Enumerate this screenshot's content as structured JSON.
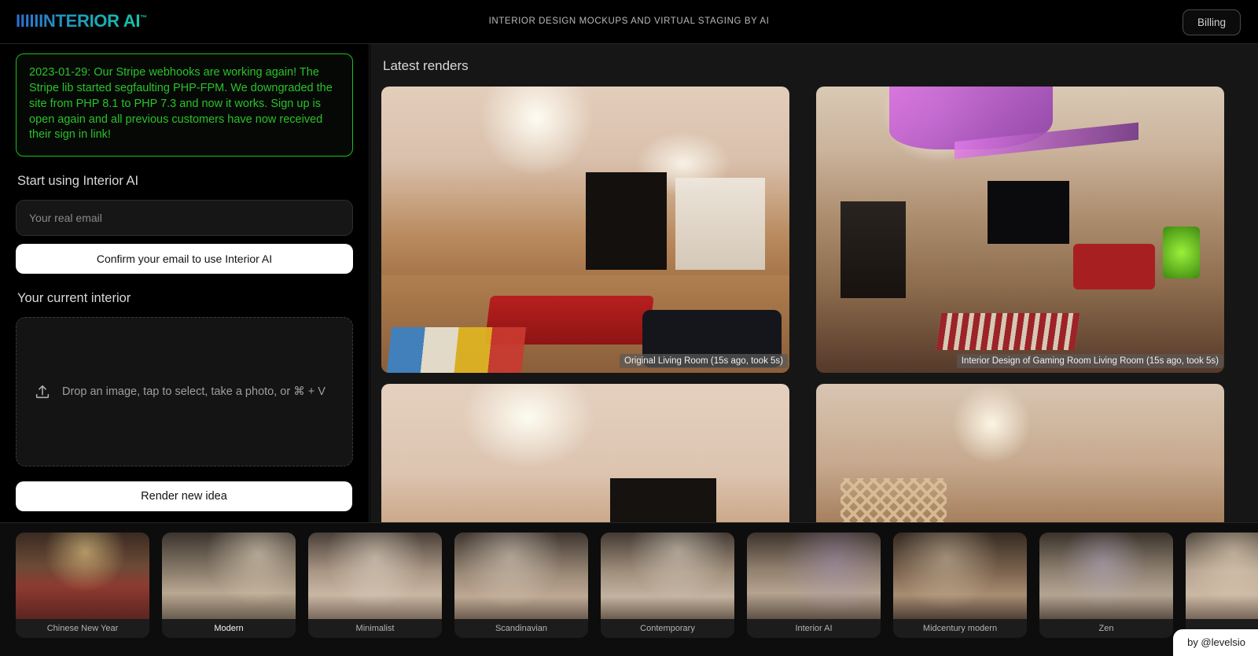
{
  "header": {
    "logo_prefix": "IIIII",
    "logo_text": "INTERIOR AI",
    "logo_tm": "™",
    "tagline": "INTERIOR DESIGN MOCKUPS AND VIRTUAL STAGING BY AI",
    "billing_label": "Billing",
    "logo_gradient_from": "#2f6fd0",
    "logo_gradient_to": "#12c9a4"
  },
  "notice": {
    "text": "2023-01-29: Our Stripe webhooks are working again! The Stripe lib started segfaulting PHP-FPM. We downgraded the site from PHP 8.1 to PHP 7.3 and now it works. Sign up is open again and all previous customers have now received their sign in link!",
    "color": "#29c229",
    "border_color": "#17c217"
  },
  "sidebar": {
    "start_title": "Start using Interior AI",
    "email_placeholder": "Your real email",
    "email_value": "",
    "confirm_label": "Confirm your email to use Interior AI",
    "current_interior_title": "Your current interior",
    "dropzone_label": "Drop an image, tap to select, take a photo, or ⌘ + V",
    "dropzone_icon": "upload-icon",
    "render_label": "Render new idea"
  },
  "main": {
    "title": "Latest renders",
    "renders": [
      {
        "caption": "Original Living Room (15s ago, took 5s)",
        "variant": "big-orig"
      },
      {
        "caption": "Interior Design of Gaming Room Living Room (15s ago, took 5s)",
        "variant": "big-game"
      },
      {
        "caption": "",
        "variant": "big-orig2"
      },
      {
        "caption": "",
        "variant": "big-warm"
      }
    ]
  },
  "filmstrip": {
    "styles": [
      {
        "label": "Chinese New Year",
        "variant": "r-cny",
        "selected": false
      },
      {
        "label": "Modern",
        "variant": "r-mod",
        "selected": true
      },
      {
        "label": "Minimalist",
        "variant": "r-min",
        "selected": false
      },
      {
        "label": "Scandinavian",
        "variant": "r-scan",
        "selected": false
      },
      {
        "label": "Contemporary",
        "variant": "r-cont",
        "selected": false
      },
      {
        "label": "Interior AI",
        "variant": "r-iai",
        "selected": false
      },
      {
        "label": "Midcentury modern",
        "variant": "r-mid",
        "selected": false
      },
      {
        "label": "Zen",
        "variant": "r-zen",
        "selected": false
      },
      {
        "label": "",
        "variant": "r-last",
        "selected": false
      }
    ]
  },
  "footer": {
    "by_label": "by @levelsio"
  }
}
